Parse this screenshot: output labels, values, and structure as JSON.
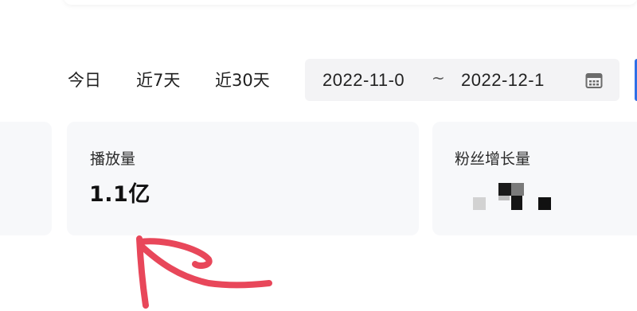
{
  "range_tabs": [
    "今日",
    "近7天",
    "近30天"
  ],
  "date_range": {
    "start": "2022-11-0",
    "separator": "~",
    "end": "2022-12-1"
  },
  "metrics": [
    {
      "label": "播放量",
      "value": "1.1亿"
    },
    {
      "label": "粉丝增长量",
      "value": ""
    }
  ],
  "icons": {
    "calendar": "calendar-icon"
  },
  "colors": {
    "annotation_arrow": "#e8475a",
    "accent": "#2f6fe6"
  }
}
